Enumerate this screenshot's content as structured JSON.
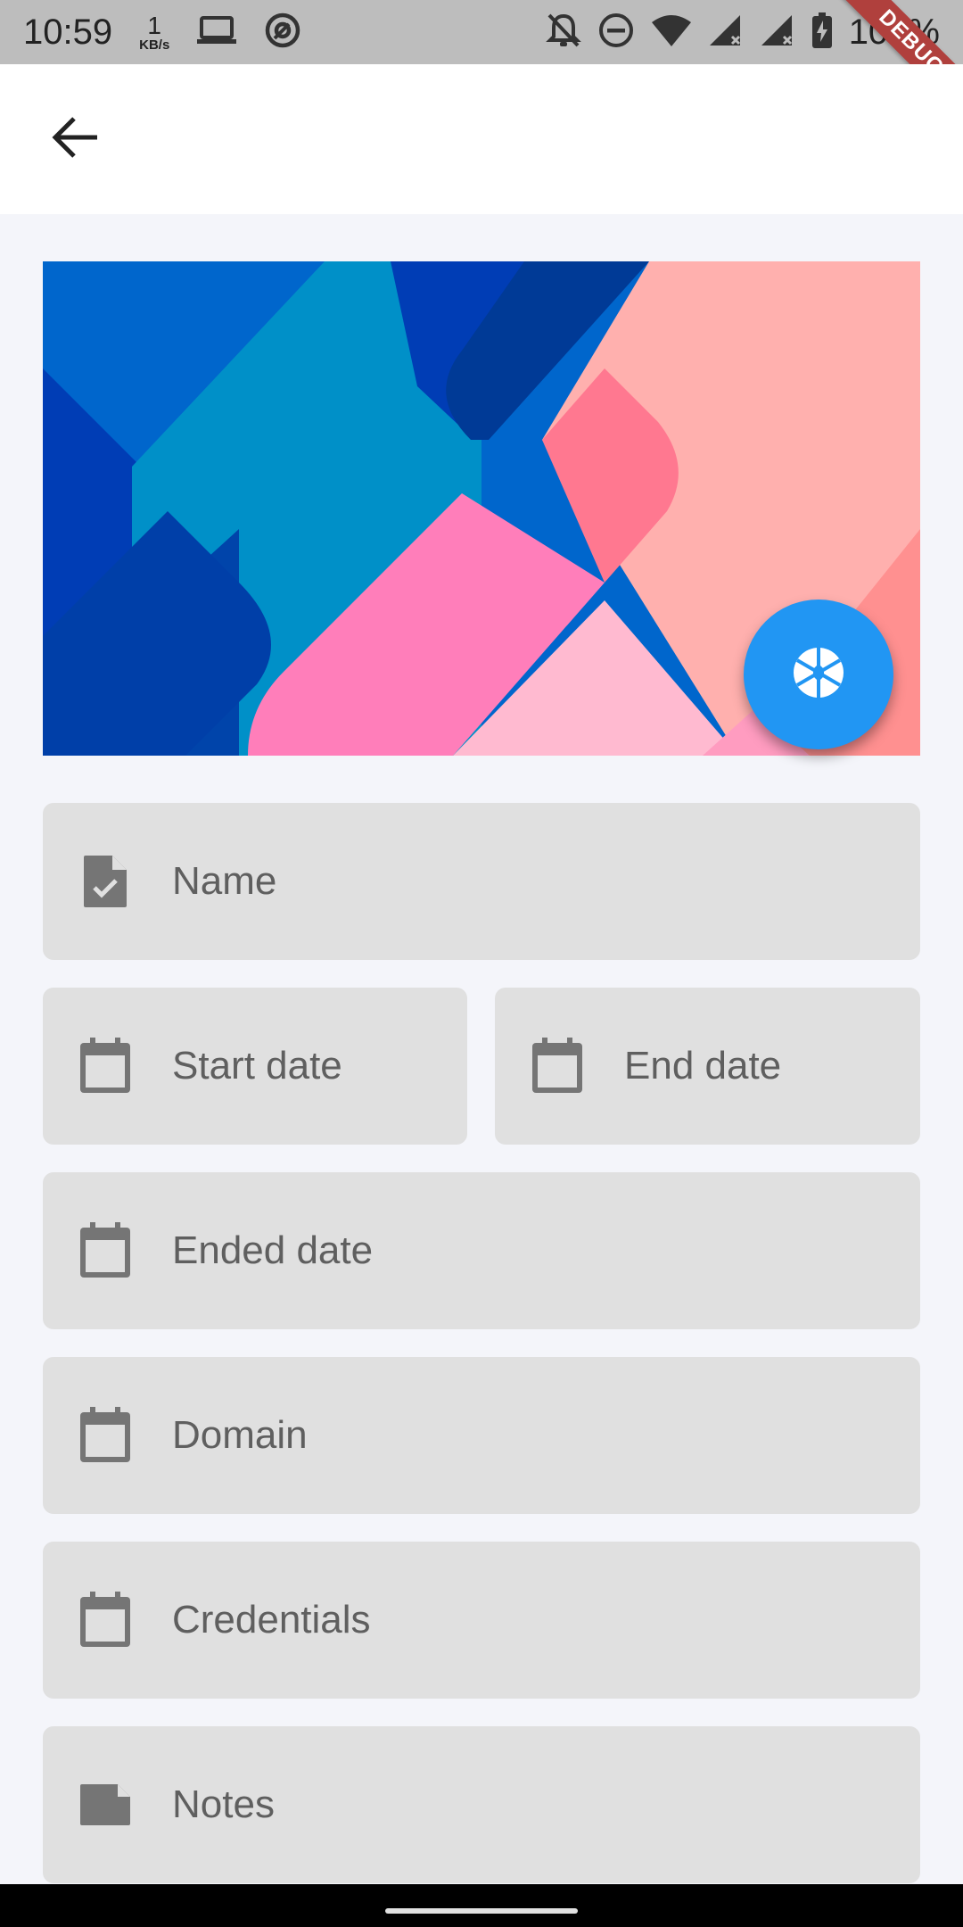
{
  "status_bar": {
    "time": "10:59",
    "net_speed_value": "1",
    "net_speed_unit": "KB/s",
    "battery": "100%",
    "icons": [
      "laptop-icon",
      "at-icon",
      "bell-off-icon",
      "dnd-icon",
      "wifi-icon",
      "signal-icon",
      "signal-icon",
      "battery-icon"
    ]
  },
  "debug_banner": "DEBUG",
  "app_bar": {
    "back_icon": "arrow-back-icon"
  },
  "hero": {
    "colors": [
      "#0066cc",
      "#0090c8",
      "#003db5",
      "#ffb0ae",
      "#ff7eba"
    ],
    "fab_icon": "camera-aperture-icon",
    "fab_color": "#2196f3"
  },
  "form": {
    "name": {
      "placeholder": "Name",
      "icon": "file-check-icon"
    },
    "start_date": {
      "placeholder": "Start date",
      "icon": "calendar-icon"
    },
    "end_date": {
      "placeholder": "End date",
      "icon": "calendar-icon"
    },
    "ended_date": {
      "placeholder": "Ended date",
      "icon": "calendar-icon"
    },
    "domain": {
      "placeholder": "Domain",
      "icon": "calendar-icon"
    },
    "credentials": {
      "placeholder": "Credentials",
      "icon": "calendar-icon"
    },
    "notes": {
      "placeholder": "Notes",
      "icon": "note-icon"
    }
  }
}
